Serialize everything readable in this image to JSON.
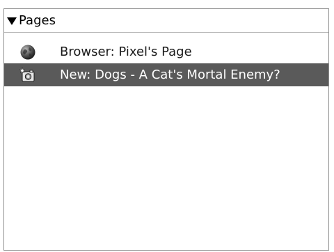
{
  "panel": {
    "title": "Pages",
    "items": [
      {
        "icon": "globe-icon",
        "label": "Browser: Pixel's Page",
        "selected": false
      },
      {
        "icon": "new-page-icon",
        "label": "New: Dogs - A Cat's Mortal Enemy?",
        "selected": true
      }
    ]
  },
  "colors": {
    "selection_bg": "#5a5a5a",
    "border": "#8e8e8e"
  }
}
